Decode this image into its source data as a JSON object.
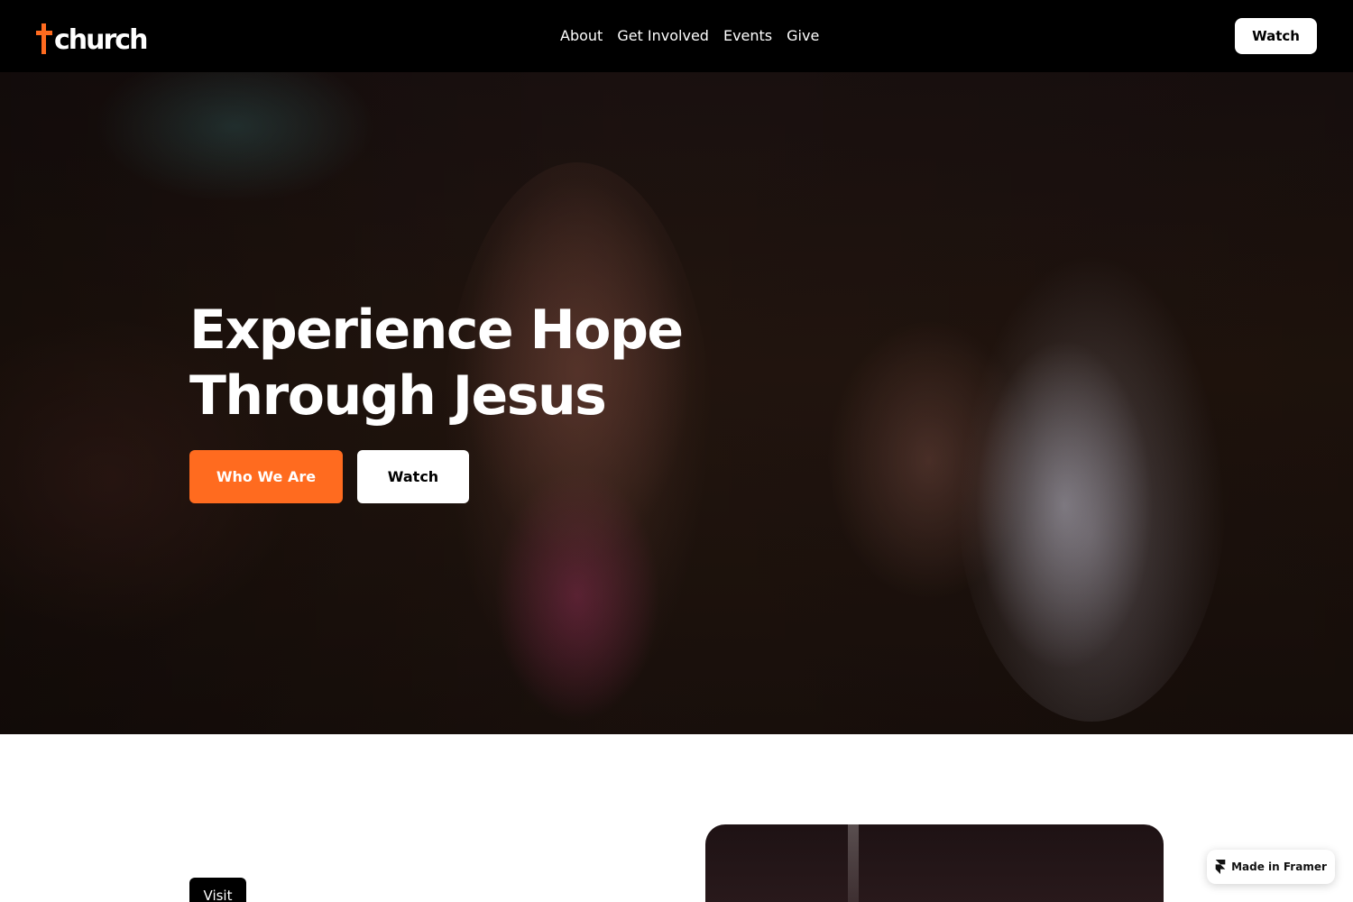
{
  "brand": {
    "logo_text": "church",
    "accent_color": "#ff6b1f"
  },
  "nav": {
    "items": [
      "About",
      "Get Involved",
      "Events",
      "Give"
    ],
    "watch_label": "Watch"
  },
  "hero": {
    "title": "Experience Hope Through Jesus",
    "primary_button": "Who We Are",
    "secondary_button": "Watch"
  },
  "section": {
    "badge_label": "Visit"
  },
  "framer_badge": {
    "label": "Made in Framer",
    "icon": "framer-icon"
  }
}
